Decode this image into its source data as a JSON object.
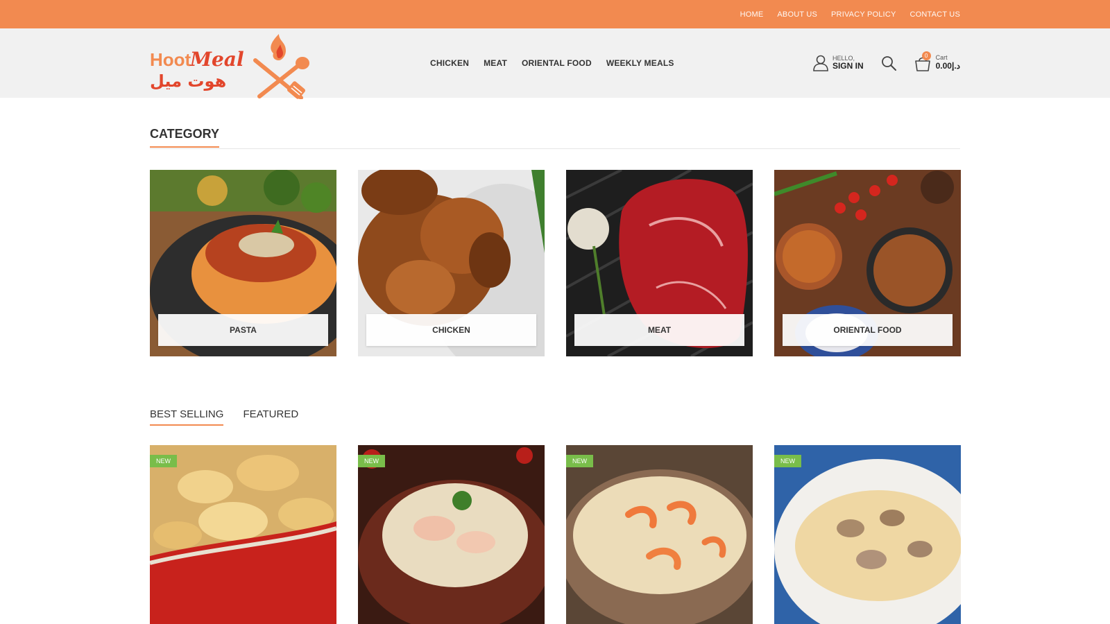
{
  "topbar": {
    "links": [
      {
        "label": "HOME"
      },
      {
        "label": "ABOUT US"
      },
      {
        "label": "PRIVACY POLICY"
      },
      {
        "label": "CONTACT US"
      }
    ]
  },
  "brand": {
    "name_en_1": "Hoot",
    "name_en_2": "Meal",
    "name_ar": "هوت ميل",
    "accent": "#f28a50"
  },
  "nav": {
    "items": [
      {
        "label": "CHICKEN"
      },
      {
        "label": "MEAT"
      },
      {
        "label": "ORIENTAL FOOD"
      },
      {
        "label": "WEEKLY MEALS"
      }
    ]
  },
  "account": {
    "hello": "HELLO,",
    "signin": "SIGN IN"
  },
  "cart": {
    "label": "Cart",
    "total": "0.00د.إ",
    "count": "0"
  },
  "category": {
    "title": "CATEGORY",
    "items": [
      {
        "label": "PASTA",
        "icon": "pasta-photo"
      },
      {
        "label": "CHICKEN",
        "icon": "roast-chicken-photo"
      },
      {
        "label": "MEAT",
        "icon": "raw-steak-photo"
      },
      {
        "label": "ORIENTAL FOOD",
        "icon": "oriental-dishes-photo"
      }
    ]
  },
  "tabs": {
    "items": [
      {
        "label": "BEST SELLING",
        "active": true
      },
      {
        "label": "FEATURED",
        "active": false
      }
    ]
  },
  "products": [
    {
      "badge": "NEW",
      "icon": "mac-and-cheese-photo"
    },
    {
      "badge": "NEW",
      "icon": "fusilli-chicken-photo"
    },
    {
      "badge": "NEW",
      "icon": "shrimp-spaghetti-photo"
    },
    {
      "badge": "NEW",
      "icon": "mushroom-pasta-photo"
    }
  ],
  "colors": {
    "topbar": "#f28a50",
    "header_bg": "#f1f1f1",
    "badge": "#79bd4a"
  }
}
